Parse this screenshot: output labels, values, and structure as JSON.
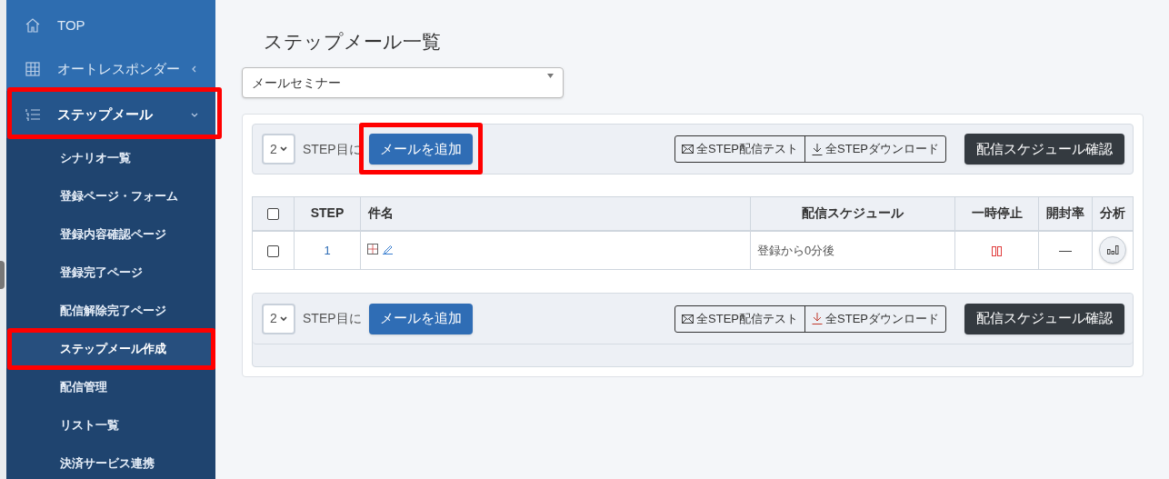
{
  "sidebar": {
    "items": [
      {
        "label": "TOP",
        "selected": false,
        "highlighted": false
      },
      {
        "label": "オートレスポンダー",
        "selected": false,
        "highlighted": false,
        "expanded": false
      },
      {
        "label": "ステップメール",
        "selected": true,
        "highlighted": true,
        "expanded": true,
        "children": [
          {
            "label": "シナリオ一覧",
            "selected": false,
            "highlighted": false
          },
          {
            "label": "登録ページ・フォーム",
            "selected": false,
            "highlighted": false
          },
          {
            "label": "登録内容確認ページ",
            "selected": false,
            "highlighted": false
          },
          {
            "label": "登録完了ページ",
            "selected": false,
            "highlighted": false
          },
          {
            "label": "配信解除完了ページ",
            "selected": false,
            "highlighted": false
          },
          {
            "label": "ステップメール作成",
            "selected": true,
            "highlighted": true
          },
          {
            "label": "配信管理",
            "selected": false,
            "highlighted": false
          },
          {
            "label": "リスト一覧",
            "selected": false,
            "highlighted": false
          },
          {
            "label": "決済サービス連携",
            "selected": false,
            "highlighted": false
          }
        ]
      }
    ]
  },
  "page_title": "ステップメール一覧",
  "scenario_select": {
    "value": "メールセミナー"
  },
  "toolbars": [
    {
      "step_select": "2",
      "step_label": "STEP目に",
      "add_button": "メールを追加",
      "add_highlighted": true,
      "test_button": "全STEP配信テスト",
      "download_button": "全STEPダウンロード",
      "schedule_button": "配信スケジュール確認"
    },
    {
      "step_select": "2",
      "step_label": "STEP目に",
      "add_button": "メールを追加",
      "add_highlighted": false,
      "test_button": "全STEP配信テスト",
      "download_button": "全STEPダウンロード",
      "schedule_button": "配信スケジュール確認"
    }
  ],
  "table": {
    "select_all_checked": false,
    "columns": [
      "STEP",
      "件名",
      "配信スケジュール",
      "一時停止",
      "開封率",
      "分析"
    ],
    "rows": [
      {
        "checked": false,
        "step": "1",
        "schedule": "登録から0分後",
        "open_rate": "—"
      }
    ]
  }
}
